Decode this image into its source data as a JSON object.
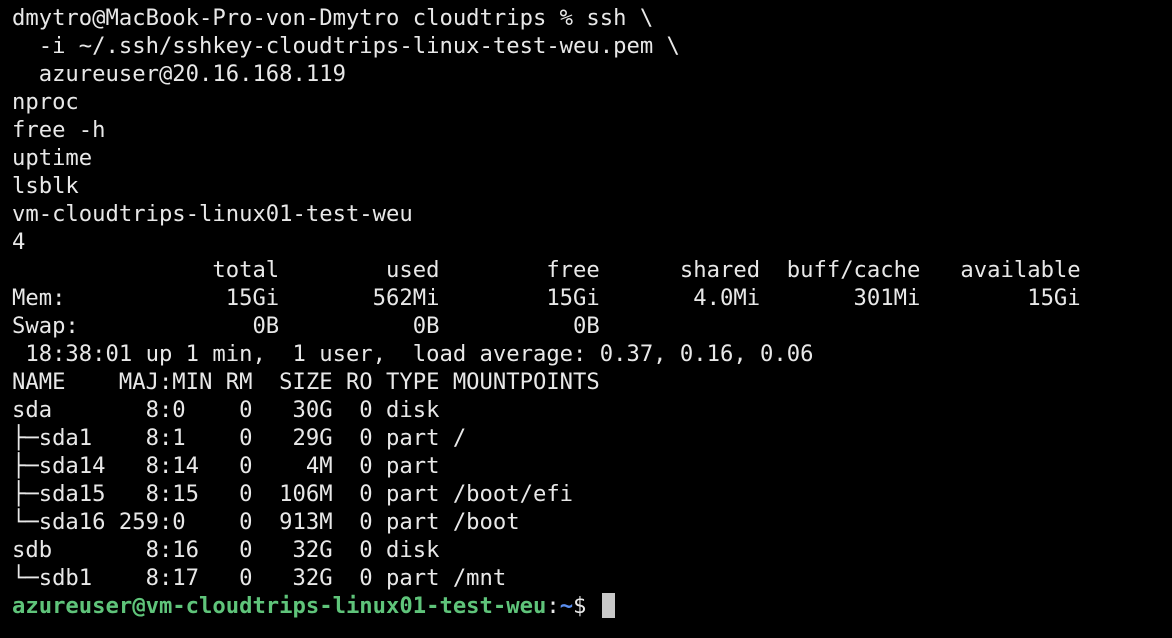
{
  "colors": {
    "background": "#000000",
    "text": "#e8e8e8",
    "prompt_user": "#5fc47a",
    "prompt_path": "#5b8ff0",
    "cursor": "#c8c8c8"
  },
  "terminal": {
    "lines": [
      "dmytro@MacBook-Pro-von-Dmytro cloudtrips % ssh \\",
      "  -i ~/.ssh/sshkey-cloudtrips-linux-test-weu.pem \\",
      "  azureuser@20.16.168.119",
      "nproc",
      "free -h",
      "uptime",
      "lsblk",
      "vm-cloudtrips-linux01-test-weu",
      "4",
      "               total        used        free      shared  buff/cache   available",
      "Mem:            15Gi       562Mi        15Gi       4.0Mi       301Mi        15Gi",
      "Swap:             0B          0B          0B",
      " 18:38:01 up 1 min,  1 user,  load average: 0.37, 0.16, 0.06",
      "NAME    MAJ:MIN RM  SIZE RO TYPE MOUNTPOINTS",
      "sda       8:0    0   30G  0 disk",
      "├─sda1    8:1    0   29G  0 part /",
      "├─sda14   8:14   0    4M  0 part",
      "├─sda15   8:15   0  106M  0 part /boot/efi",
      "└─sda16 259:0    0  913M  0 part /boot",
      "sdb       8:16   0   32G  0 disk",
      "└─sdb1    8:17   0   32G  0 part /mnt"
    ],
    "prompt": {
      "user_host": "azureuser@vm-cloudtrips-linux01-test-weu",
      "separator": ":",
      "path": "~",
      "symbol": "$ "
    }
  }
}
